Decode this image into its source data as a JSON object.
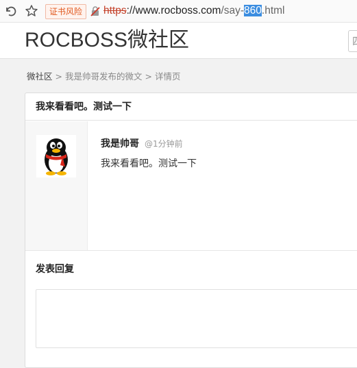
{
  "browser": {
    "cert_warning": "证书风险",
    "url": {
      "scheme": "https",
      "rest": "://",
      "domain": "www.rocboss.com",
      "path_before": "/say-",
      "path_selected": "860",
      "path_after": ".html"
    },
    "icons": [
      "back-icon",
      "star-icon",
      "insecure-lock-icon"
    ]
  },
  "site": {
    "logo": "ROCBOSS微社区",
    "search_placeholder": "四"
  },
  "breadcrumb": {
    "home": "微社区",
    "separator": ">",
    "items": [
      "我是帅哥发布的微文",
      "详情页"
    ]
  },
  "post": {
    "title": "我来看看吧。测试一下",
    "author": "我是帅哥",
    "time": "@1分钟前",
    "content": "我来看看吧。测试一下",
    "avatar_icon": "qq-penguin-avatar"
  },
  "reply": {
    "title": "发表回复",
    "value": ""
  },
  "colors": {
    "cert_warning": "#e0581e",
    "url_selection": "#3b8de0",
    "insecure_scheme": "#c4422b"
  }
}
